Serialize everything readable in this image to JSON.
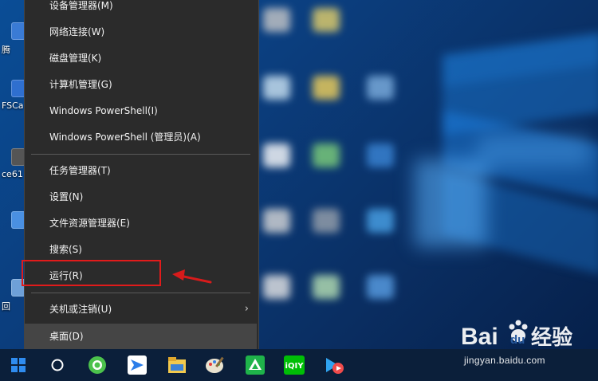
{
  "menu": {
    "items_group1": [
      {
        "label": "设备管理器(M)",
        "name": "menu-item-device-manager"
      },
      {
        "label": "网络连接(W)",
        "name": "menu-item-network-connections"
      },
      {
        "label": "磁盘管理(K)",
        "name": "menu-item-disk-management"
      },
      {
        "label": "计算机管理(G)",
        "name": "menu-item-computer-management"
      },
      {
        "label": "Windows PowerShell(I)",
        "name": "menu-item-powershell"
      },
      {
        "label": "Windows PowerShell (管理员)(A)",
        "name": "menu-item-powershell-admin"
      }
    ],
    "items_group2": [
      {
        "label": "任务管理器(T)",
        "name": "menu-item-task-manager"
      },
      {
        "label": "设置(N)",
        "name": "menu-item-settings"
      },
      {
        "label": "文件资源管理器(E)",
        "name": "menu-item-file-explorer"
      },
      {
        "label": "搜索(S)",
        "name": "menu-item-search"
      },
      {
        "label": "运行(R)",
        "name": "menu-item-run"
      }
    ],
    "shutdown_label": "关机或注销(U)",
    "desktop_label": "桌面(D)"
  },
  "desktop_icons": [
    {
      "label": "腾",
      "icon": "app-icon"
    },
    {
      "label": "FSCa",
      "icon": "app-icon"
    },
    {
      "label": "ce61",
      "icon": "app-icon"
    },
    {
      "label": "回",
      "icon": "recycle-bin-icon"
    }
  ],
  "taskbar": {
    "icons": [
      "windows-start-icon",
      "cortana-search-icon",
      "browser-icon",
      "messenger-icon",
      "file-explorer-icon",
      "paint-icon",
      "green-app-icon",
      "iqiyi-icon",
      "video-player-icon"
    ]
  },
  "annotation": {
    "color": "#e11b1b"
  },
  "watermark": {
    "brand_latin": "Bai",
    "brand_du": "du",
    "brand_cn": "经验",
    "url": "jingyan.baidu.com"
  }
}
